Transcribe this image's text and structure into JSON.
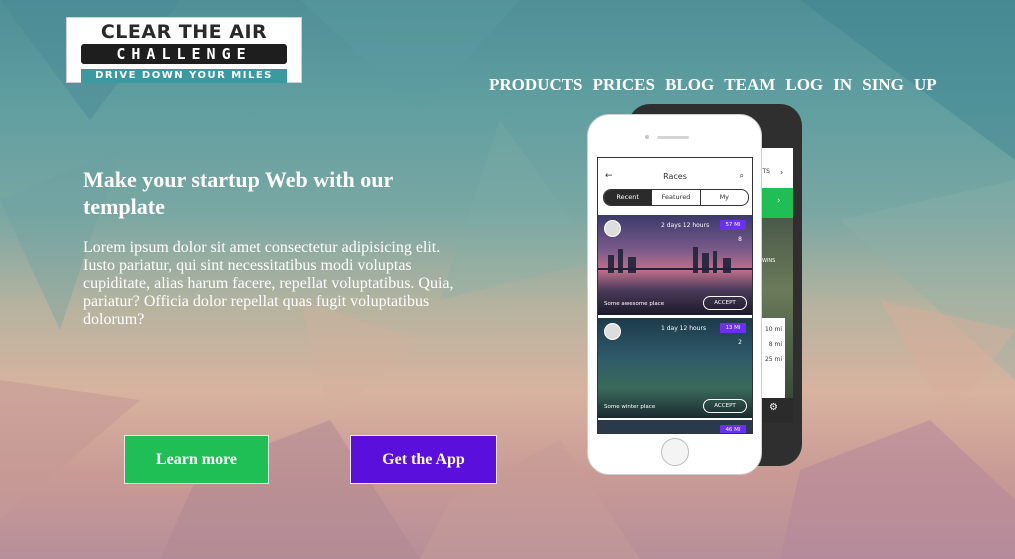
{
  "logo": {
    "line1": "CLEAR THE AIR",
    "line2": "CHALLENGE",
    "line3": "DRIVE DOWN YOUR MILES"
  },
  "nav": {
    "items": [
      "PRODUCTS",
      "PRICES",
      "BLOG",
      "TEAM",
      "LOG",
      "IN",
      "SING",
      "UP"
    ]
  },
  "hero": {
    "headline": "Make your startup Web with our template",
    "body": "Lorem ipsum dolor sit amet consectetur adipisicing elit. Iusto pariatur, qui sint necessitatibus modi voluptas cupiditate, alias harum facere, repellat voluptatibus. Quia, pariatur? Officia dolor repellat quas fugit voluptatibus dolorum?",
    "learn_more": "Learn more",
    "get_app": "Get the App"
  },
  "phone_front": {
    "title": "Races",
    "tabs": [
      "Recent",
      "Featured",
      "My"
    ],
    "cards": [
      {
        "time": "2 days 12 hours",
        "badge": "57 MI",
        "count": "8",
        "place": "Some awesome place",
        "accept": "ACCEPT"
      },
      {
        "time": "1 day 12 hours",
        "badge": "13 MI",
        "count": "2",
        "place": "Some winter place",
        "accept": "ACCEPT"
      },
      {
        "badge": "46 MI"
      }
    ]
  },
  "phone_back": {
    "label": "NTS",
    "wins": "WINS",
    "distances": [
      "10 mi",
      "8 mi",
      "25 mi"
    ]
  },
  "colors": {
    "learn_more": "#1fbf55",
    "get_app": "#5a0fdc",
    "badge": "#6a2ff0"
  }
}
